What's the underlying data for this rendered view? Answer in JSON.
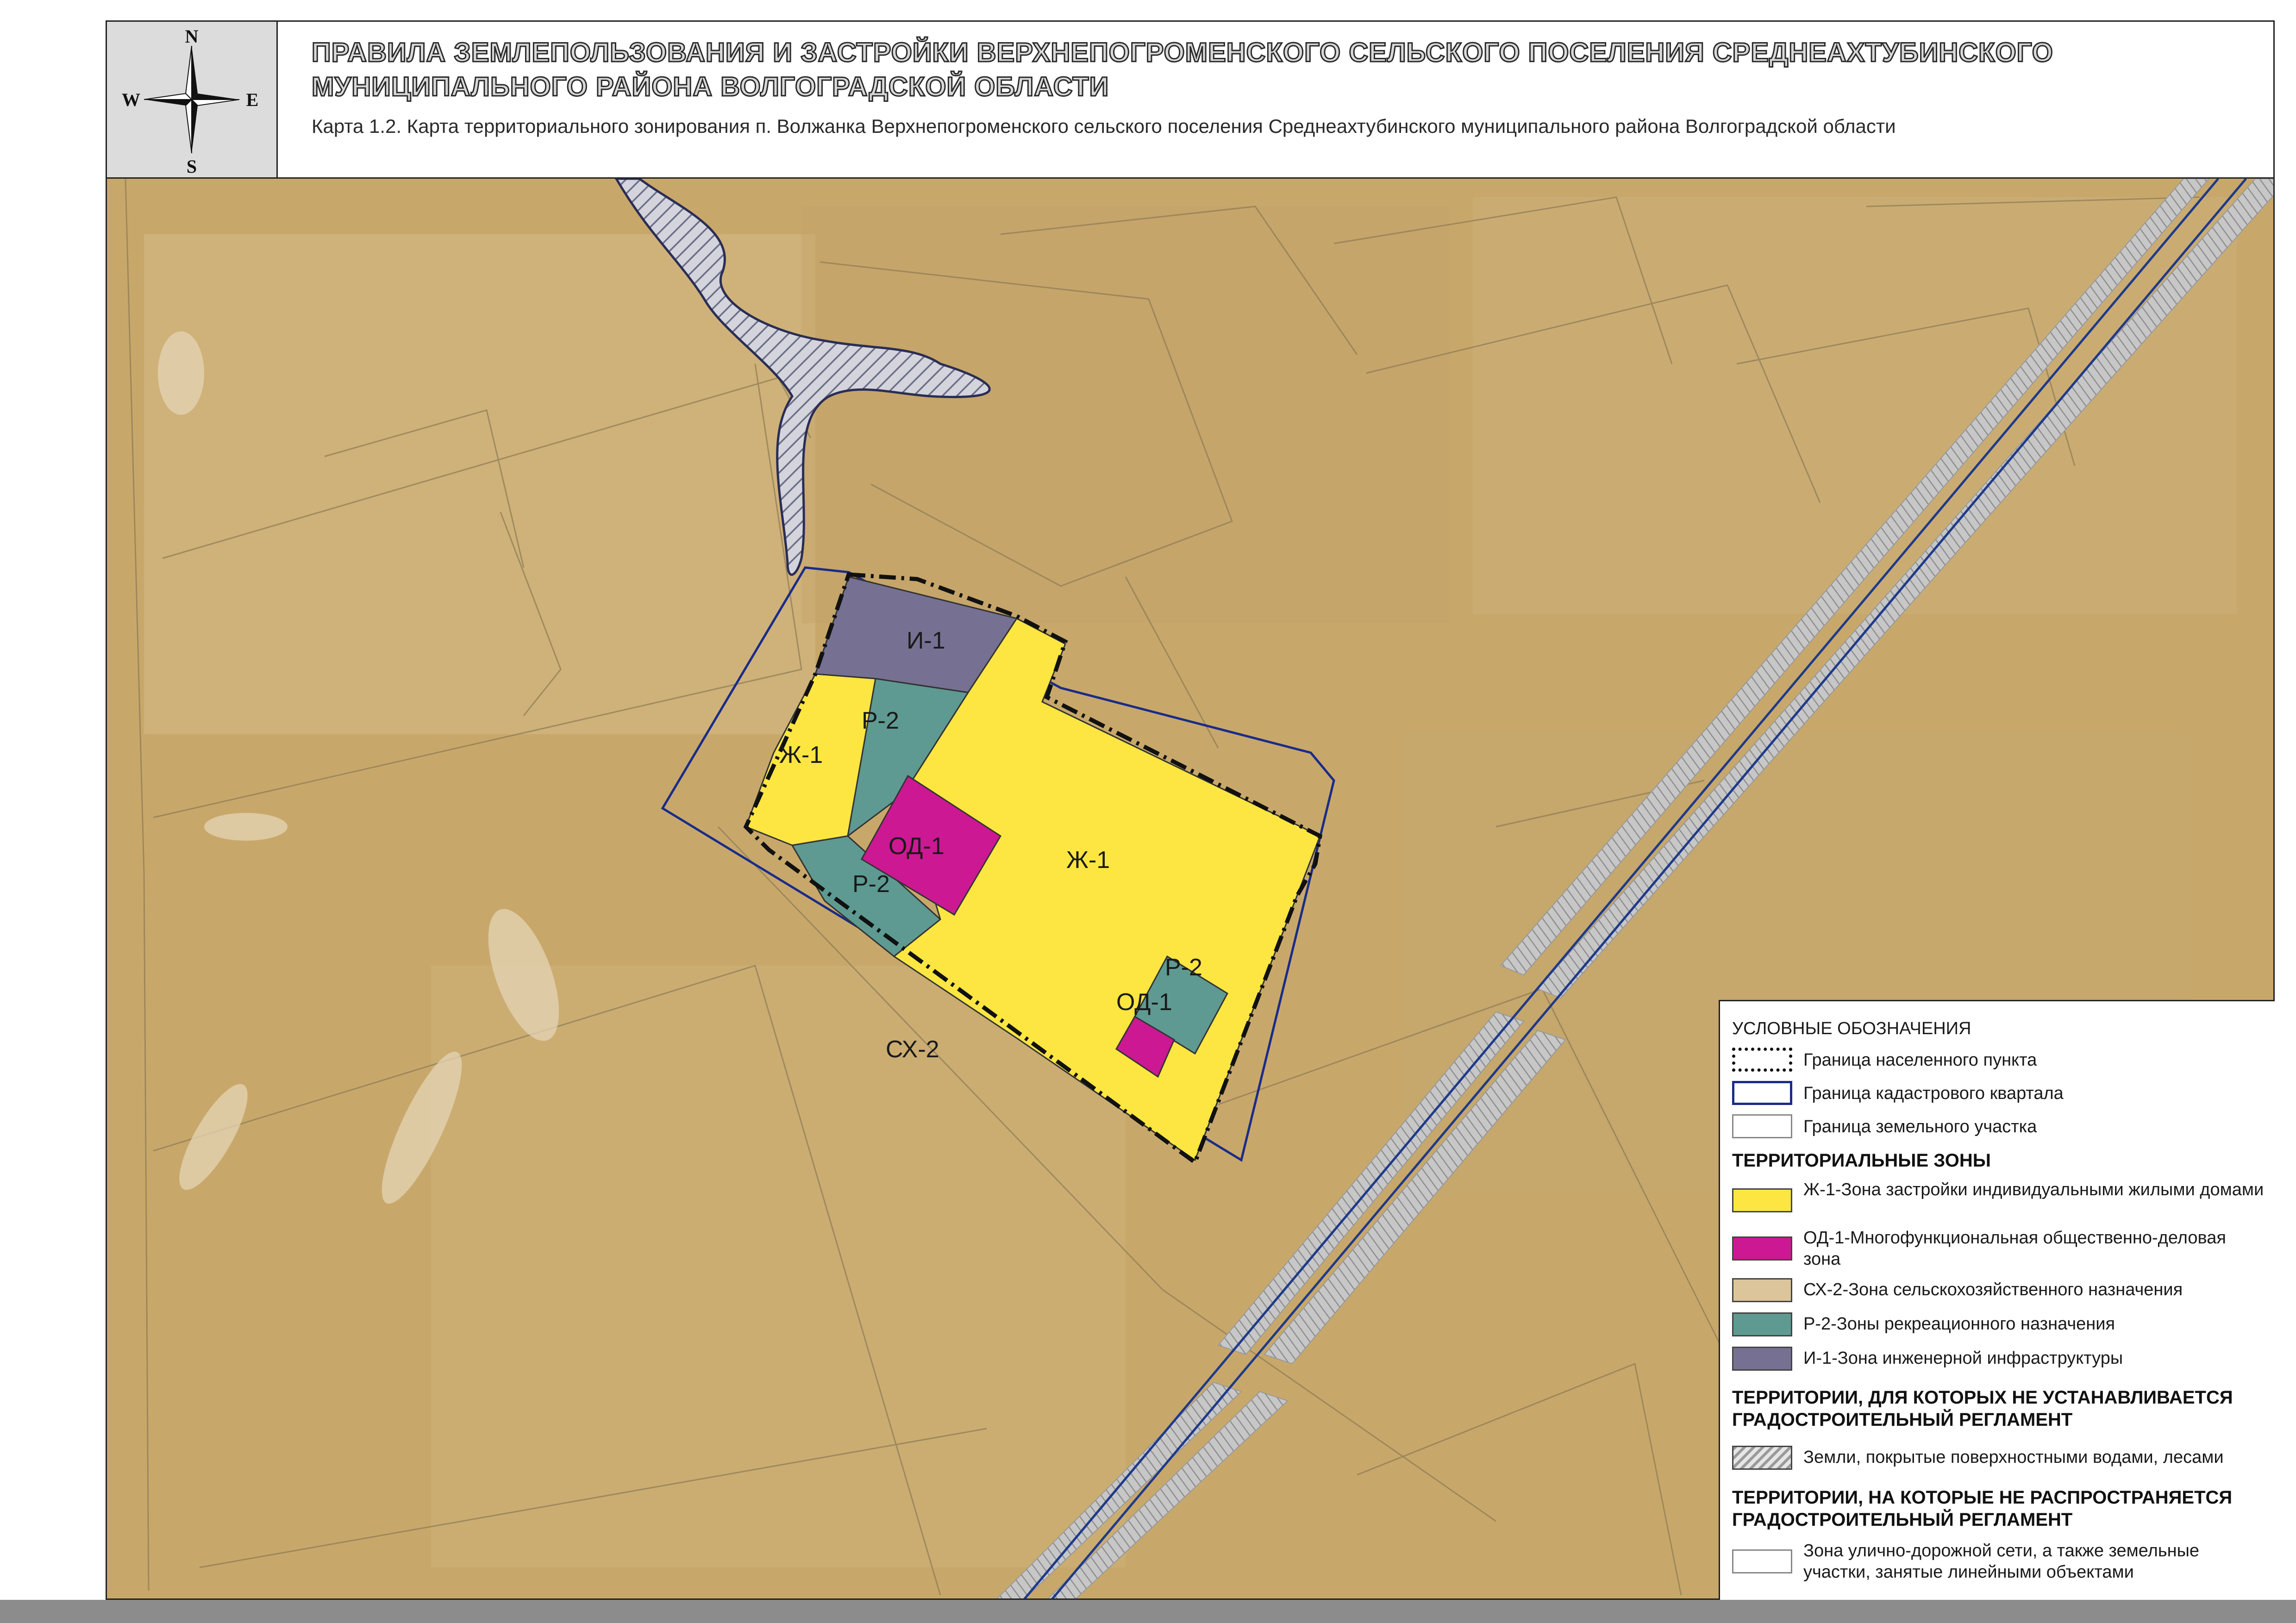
{
  "header": {
    "title": "ПРАВИЛА ЗЕМЛЕПОЛЬЗОВАНИЯ И ЗАСТРОЙКИ ВЕРХНЕПОГРОМЕНСКОГО СЕЛЬСКОГО ПОСЕЛЕНИЯ СРЕДНЕАХТУБИНСКОГО МУНИЦИПАЛЬНОГО РАЙОНА ВОЛГОГРАДСКОЙ ОБЛАСТИ",
    "subtitle": "Карта 1.2. Карта территориального зонирования п. Волжанка Верхнепогроменского сельского поселения Среднеахтубинского муниципального района Волгоградской области"
  },
  "compass": {
    "n": "N",
    "s": "S",
    "e": "E",
    "w": "W",
    "icon": "compass-rose-icon"
  },
  "map": {
    "labels": {
      "i1": "И-1",
      "zh1_left": "Ж-1",
      "r2_top": "Р-2",
      "od1_main": "ОД-1",
      "zh1_main": "Ж-1",
      "r2_bottom": "Р-2",
      "r2_small": "Р-2",
      "od1_small": "ОД-1",
      "skh2": "СХ-2"
    }
  },
  "legend": {
    "title": "УСЛОВНЫЕ ОБОЗНАЧЕНИЯ",
    "boundaries": [
      {
        "label": "Граница населенного пункта"
      },
      {
        "label": "Граница кадастрового квартала"
      },
      {
        "label": "Граница земельного участка"
      }
    ],
    "zones_heading": "ТЕРРИТОРИАЛЬНЫЕ ЗОНЫ",
    "zones": [
      {
        "label": "Ж-1-Зона застройки индивидуальными жилыми домами",
        "color": "#fde641"
      },
      {
        "label": "ОД-1-Многофункциональная общественно-деловая зона",
        "color": "#cc1893"
      },
      {
        "label": "СХ-2-Зона сельскохозяйственного назначения",
        "color": "#dcc59a"
      },
      {
        "label": "Р-2-Зоны рекреационного назначения",
        "color": "#5e9a91"
      },
      {
        "label": "И-1-Зона инженерной инфраструктуры",
        "color": "#767193"
      }
    ],
    "no_regulation_heading": "ТЕРРИТОРИИ, ДЛЯ КОТОРЫХ НЕ УСТАНАВЛИВАЕТСЯ ГРАДОСТРОИТЕЛЬНЫЙ РЕГЛАМЕНТ",
    "no_regulation_item": "Земли, покрытые поверхностными водами, лесами",
    "not_applicable_heading": "ТЕРРИТОРИИ, НА КОТОРЫЕ НЕ РАСПРОСТРАНЯЕТСЯ ГРАДОСТРОИТЕЛЬНЫЙ РЕГЛАМЕНТ",
    "not_applicable_item": "Зона улично-дорожной сети, а также земельные участки, занятые линейными объектами"
  }
}
